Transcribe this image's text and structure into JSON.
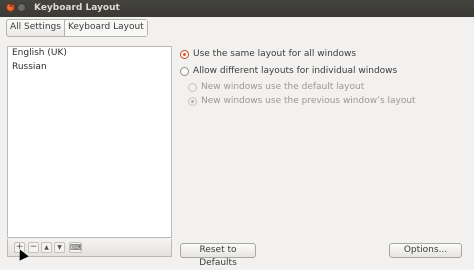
{
  "window": {
    "title": "Keyboard Layout"
  },
  "breadcrumb": {
    "items": [
      "All Settings",
      "Keyboard Layout"
    ]
  },
  "layouts": {
    "items": [
      "English (UK)",
      "Russian"
    ]
  },
  "list_toolbar": {
    "add_glyph": "+",
    "remove_glyph": "−",
    "up_glyph": "▲",
    "down_glyph": "▼",
    "keyboard_glyph": "⌨"
  },
  "options": {
    "same_layout": "Use the same layout for all windows",
    "different_layouts": "Allow different layouts for individual windows",
    "default_layout": "New windows use the default layout",
    "previous_layout": "New windows use the previous window’s layout"
  },
  "buttons": {
    "reset": "Reset to Defaults",
    "options": "Options..."
  },
  "colors": {
    "accent": "#e05a25",
    "titlebar": "#3e3d39",
    "background": "#f2f1f0"
  }
}
